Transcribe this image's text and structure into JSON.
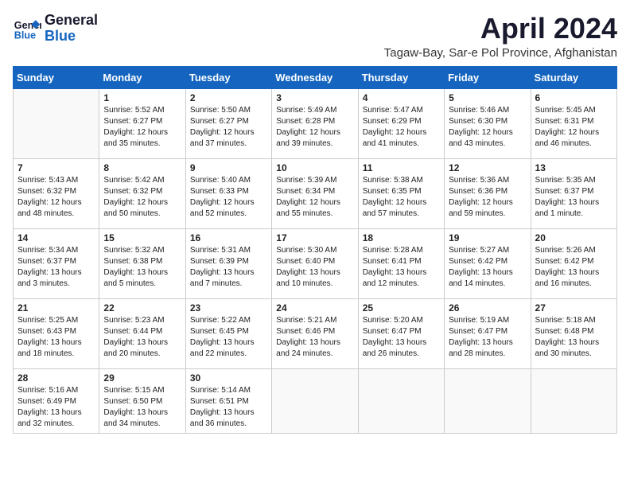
{
  "header": {
    "logo_line1": "General",
    "logo_line2": "Blue",
    "month_title": "April 2024",
    "subtitle": "Tagaw-Bay, Sar-e Pol Province, Afghanistan"
  },
  "weekdays": [
    "Sunday",
    "Monday",
    "Tuesday",
    "Wednesday",
    "Thursday",
    "Friday",
    "Saturday"
  ],
  "weeks": [
    [
      {
        "day": "",
        "content": ""
      },
      {
        "day": "1",
        "content": "Sunrise: 5:52 AM\nSunset: 6:27 PM\nDaylight: 12 hours\nand 35 minutes."
      },
      {
        "day": "2",
        "content": "Sunrise: 5:50 AM\nSunset: 6:27 PM\nDaylight: 12 hours\nand 37 minutes."
      },
      {
        "day": "3",
        "content": "Sunrise: 5:49 AM\nSunset: 6:28 PM\nDaylight: 12 hours\nand 39 minutes."
      },
      {
        "day": "4",
        "content": "Sunrise: 5:47 AM\nSunset: 6:29 PM\nDaylight: 12 hours\nand 41 minutes."
      },
      {
        "day": "5",
        "content": "Sunrise: 5:46 AM\nSunset: 6:30 PM\nDaylight: 12 hours\nand 43 minutes."
      },
      {
        "day": "6",
        "content": "Sunrise: 5:45 AM\nSunset: 6:31 PM\nDaylight: 12 hours\nand 46 minutes."
      }
    ],
    [
      {
        "day": "7",
        "content": "Sunrise: 5:43 AM\nSunset: 6:32 PM\nDaylight: 12 hours\nand 48 minutes."
      },
      {
        "day": "8",
        "content": "Sunrise: 5:42 AM\nSunset: 6:32 PM\nDaylight: 12 hours\nand 50 minutes."
      },
      {
        "day": "9",
        "content": "Sunrise: 5:40 AM\nSunset: 6:33 PM\nDaylight: 12 hours\nand 52 minutes."
      },
      {
        "day": "10",
        "content": "Sunrise: 5:39 AM\nSunset: 6:34 PM\nDaylight: 12 hours\nand 55 minutes."
      },
      {
        "day": "11",
        "content": "Sunrise: 5:38 AM\nSunset: 6:35 PM\nDaylight: 12 hours\nand 57 minutes."
      },
      {
        "day": "12",
        "content": "Sunrise: 5:36 AM\nSunset: 6:36 PM\nDaylight: 12 hours\nand 59 minutes."
      },
      {
        "day": "13",
        "content": "Sunrise: 5:35 AM\nSunset: 6:37 PM\nDaylight: 13 hours\nand 1 minute."
      }
    ],
    [
      {
        "day": "14",
        "content": "Sunrise: 5:34 AM\nSunset: 6:37 PM\nDaylight: 13 hours\nand 3 minutes."
      },
      {
        "day": "15",
        "content": "Sunrise: 5:32 AM\nSunset: 6:38 PM\nDaylight: 13 hours\nand 5 minutes."
      },
      {
        "day": "16",
        "content": "Sunrise: 5:31 AM\nSunset: 6:39 PM\nDaylight: 13 hours\nand 7 minutes."
      },
      {
        "day": "17",
        "content": "Sunrise: 5:30 AM\nSunset: 6:40 PM\nDaylight: 13 hours\nand 10 minutes."
      },
      {
        "day": "18",
        "content": "Sunrise: 5:28 AM\nSunset: 6:41 PM\nDaylight: 13 hours\nand 12 minutes."
      },
      {
        "day": "19",
        "content": "Sunrise: 5:27 AM\nSunset: 6:42 PM\nDaylight: 13 hours\nand 14 minutes."
      },
      {
        "day": "20",
        "content": "Sunrise: 5:26 AM\nSunset: 6:42 PM\nDaylight: 13 hours\nand 16 minutes."
      }
    ],
    [
      {
        "day": "21",
        "content": "Sunrise: 5:25 AM\nSunset: 6:43 PM\nDaylight: 13 hours\nand 18 minutes."
      },
      {
        "day": "22",
        "content": "Sunrise: 5:23 AM\nSunset: 6:44 PM\nDaylight: 13 hours\nand 20 minutes."
      },
      {
        "day": "23",
        "content": "Sunrise: 5:22 AM\nSunset: 6:45 PM\nDaylight: 13 hours\nand 22 minutes."
      },
      {
        "day": "24",
        "content": "Sunrise: 5:21 AM\nSunset: 6:46 PM\nDaylight: 13 hours\nand 24 minutes."
      },
      {
        "day": "25",
        "content": "Sunrise: 5:20 AM\nSunset: 6:47 PM\nDaylight: 13 hours\nand 26 minutes."
      },
      {
        "day": "26",
        "content": "Sunrise: 5:19 AM\nSunset: 6:47 PM\nDaylight: 13 hours\nand 28 minutes."
      },
      {
        "day": "27",
        "content": "Sunrise: 5:18 AM\nSunset: 6:48 PM\nDaylight: 13 hours\nand 30 minutes."
      }
    ],
    [
      {
        "day": "28",
        "content": "Sunrise: 5:16 AM\nSunset: 6:49 PM\nDaylight: 13 hours\nand 32 minutes."
      },
      {
        "day": "29",
        "content": "Sunrise: 5:15 AM\nSunset: 6:50 PM\nDaylight: 13 hours\nand 34 minutes."
      },
      {
        "day": "30",
        "content": "Sunrise: 5:14 AM\nSunset: 6:51 PM\nDaylight: 13 hours\nand 36 minutes."
      },
      {
        "day": "",
        "content": ""
      },
      {
        "day": "",
        "content": ""
      },
      {
        "day": "",
        "content": ""
      },
      {
        "day": "",
        "content": ""
      }
    ]
  ]
}
